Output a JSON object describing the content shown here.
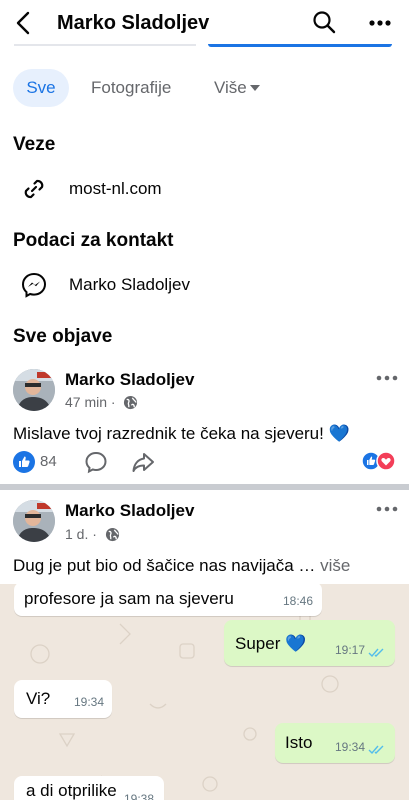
{
  "header": {
    "title": "Marko Sladoljev"
  },
  "tabs": [
    {
      "label": "Sve"
    },
    {
      "label": "Fotografije"
    },
    {
      "label": "Više"
    }
  ],
  "links_section": {
    "title": "Veze",
    "items": [
      {
        "text": "most-nl.com",
        "icon": "link-icon"
      }
    ]
  },
  "contact_section": {
    "title": "Podaci za kontakt",
    "items": [
      {
        "text": "Marko Sladoljev",
        "icon": "messenger-icon"
      }
    ]
  },
  "posts_section": {
    "title": "Sve objave"
  },
  "posts": [
    {
      "author": "Marko Sladoljev",
      "time": "47 min ·",
      "text": "Mislave tvoj razrednik te čeka na sjeveru! 💙",
      "like_count": "84"
    },
    {
      "author": "Marko Sladoljev",
      "time": "1 d. ·",
      "text": "Dug je put bio od šačice nas navijača …",
      "see_more": " više",
      "chat": [
        {
          "dir": "in",
          "text": "profesore ja sam na sjeveru",
          "time": "18:46"
        },
        {
          "dir": "out",
          "text": "Super 💙",
          "time": "19:17"
        },
        {
          "dir": "in",
          "text": "Vi?",
          "time": "19:34"
        },
        {
          "dir": "out",
          "text": "Isto",
          "time": "19:34"
        },
        {
          "dir": "in",
          "text": "a di otprilike",
          "time": "19:38"
        }
      ]
    }
  ],
  "colors": {
    "accent": "#1b74e4",
    "secondary_text": "#65676b",
    "chat_bg": "#efe7de",
    "chat_out": "#dcf8c6"
  }
}
